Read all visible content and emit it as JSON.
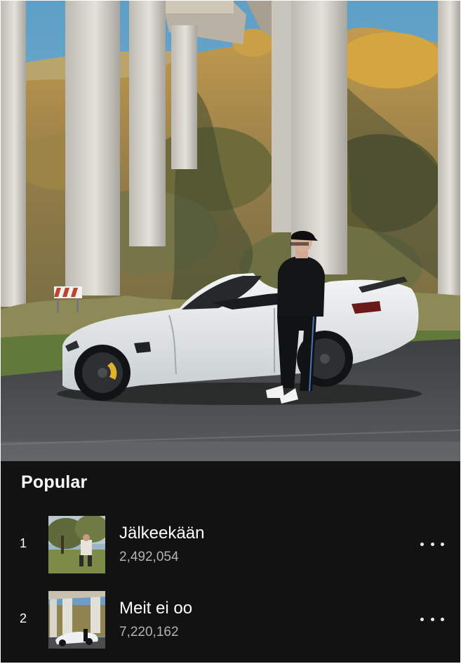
{
  "header": {
    "image_icon": "artist-header-photo"
  },
  "popular": {
    "title": "Popular",
    "tracks": [
      {
        "rank": "1",
        "title": "Jälkeekään",
        "plays": "2,492,054",
        "art_icon": "album-cover-garden"
      },
      {
        "rank": "2",
        "title": "Meit ei oo",
        "plays": "7,220,162",
        "art_icon": "album-cover-car"
      }
    ],
    "more_icon": "more-options-icon"
  },
  "colors": {
    "background": "#121212",
    "text_primary": "#ffffff",
    "text_secondary": "#b3b3b3"
  }
}
